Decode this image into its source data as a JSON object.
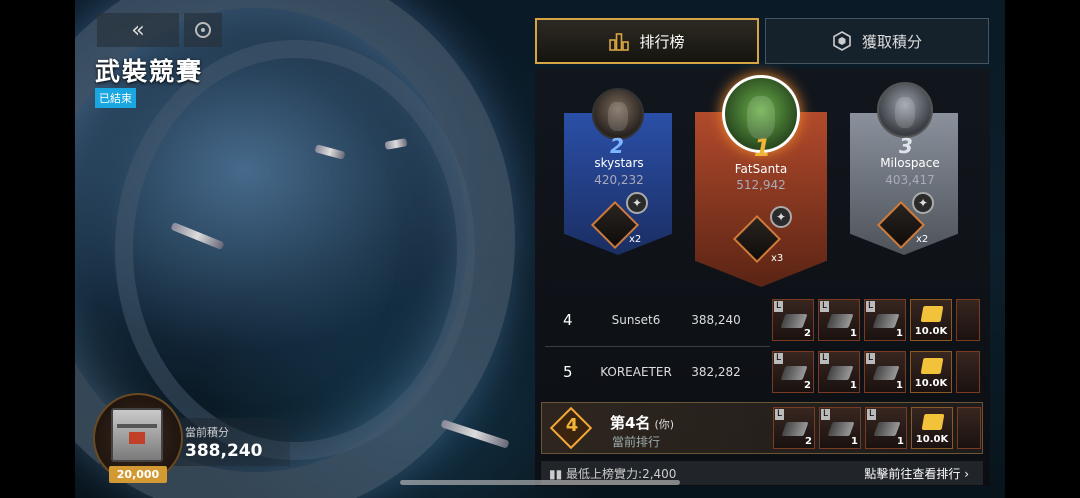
{
  "header": {
    "back_icon_glyph": "«",
    "title": "武裝競賽",
    "status_badge": "已結束"
  },
  "points": {
    "label": "當前積分",
    "value": "388,240",
    "chest_count": "20,000"
  },
  "tabs": [
    {
      "label": "排行榜",
      "active": true,
      "icon": "ranking-podium-icon"
    },
    {
      "label": "獲取積分",
      "active": false,
      "icon": "hexagon-points-icon"
    }
  ],
  "podium": [
    {
      "rank": "2",
      "name": "skystars",
      "score": "420,232",
      "reward_count": "x2"
    },
    {
      "rank": "1",
      "name": "FatSanta",
      "score": "512,942",
      "reward_count": "x3"
    },
    {
      "rank": "3",
      "name": "Milospace",
      "score": "403,417",
      "reward_count": "x2"
    }
  ],
  "rows": [
    {
      "rank": "4",
      "name": "Sunset6",
      "score": "388,240",
      "items": [
        {
          "tag": "L",
          "count": "2"
        },
        {
          "tag": "L",
          "count": "1"
        },
        {
          "tag": "L",
          "count": "1"
        },
        {
          "tag": "",
          "count": "10.0K"
        }
      ]
    },
    {
      "rank": "5",
      "name": "KOREAETER",
      "score": "382,282",
      "items": [
        {
          "tag": "L",
          "count": "2"
        },
        {
          "tag": "L",
          "count": "1"
        },
        {
          "tag": "L",
          "count": "1"
        },
        {
          "tag": "",
          "count": "10.0K"
        }
      ]
    }
  ],
  "me": {
    "rank": "4",
    "title": "第4名",
    "you": "(你)",
    "subtitle": "當前排行",
    "items": [
      {
        "tag": "L",
        "count": "2"
      },
      {
        "tag": "L",
        "count": "1"
      },
      {
        "tag": "L",
        "count": "1"
      },
      {
        "tag": "",
        "count": "10.0K"
      }
    ]
  },
  "footer": {
    "min_power": "最低上榜實力:2,400",
    "view_link": "點擊前往查看排行",
    "chevron": "›"
  },
  "colors": {
    "gold": "#d8a545",
    "rank2_blue": "#2b4fa8",
    "rank1_orange": "#b24a2c",
    "rank3_gray": "#8a919c",
    "badge_blue": "#1aa6e0"
  }
}
